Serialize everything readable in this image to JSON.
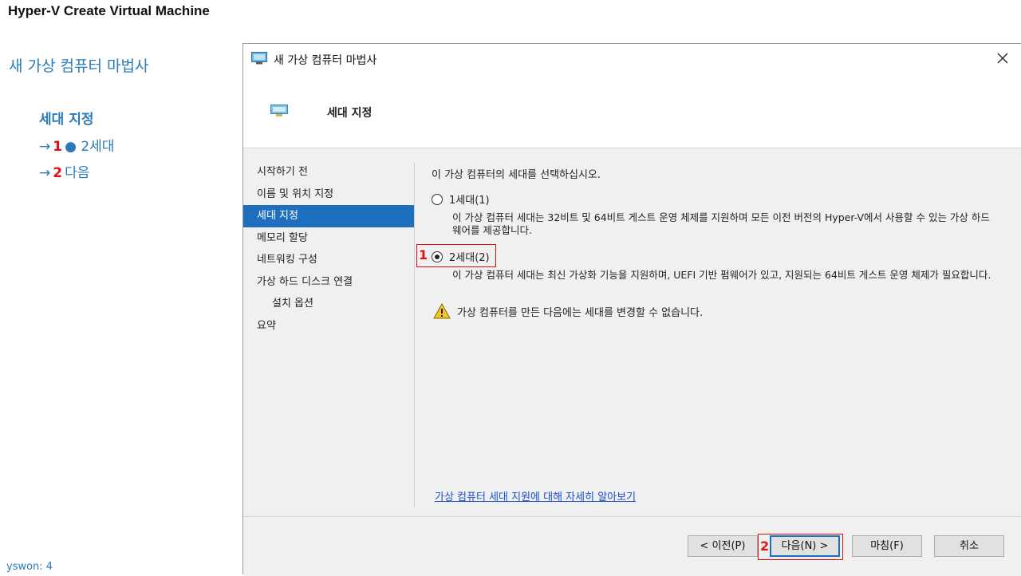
{
  "page_title": "Hyper-V Create Virtual Machine",
  "guide": {
    "title": "새 가상 컴퓨터 마법사",
    "section": "세대 지정",
    "steps": [
      {
        "arrow": "→",
        "num": "1",
        "bullet": "●",
        "text": "2세대"
      },
      {
        "arrow": "→",
        "num": "2",
        "text": "다음"
      }
    ]
  },
  "footer_note": "yswon:   4",
  "dialog": {
    "title": "새 가상 컴퓨터 마법사",
    "header": "세대 지정",
    "nav": [
      {
        "label": "시작하기 전",
        "selected": false
      },
      {
        "label": "이름 및 위치 지정",
        "selected": false
      },
      {
        "label": "세대 지정",
        "selected": true
      },
      {
        "label": "메모리 할당",
        "selected": false
      },
      {
        "label": "네트워킹 구성",
        "selected": false
      },
      {
        "label": "가상 하드 디스크 연결",
        "selected": false
      },
      {
        "label": "설치 옵션",
        "selected": false
      },
      {
        "label": "요약",
        "selected": false
      }
    ],
    "prompt": "이 가상 컴퓨터의 세대를 선택하십시오.",
    "option_gen1": {
      "label": "1세대(1)",
      "checked": false,
      "description": "이 가상 컴퓨터 세대는 32비트 및 64비트 게스트 운영 체제를 지원하며 모든 이전 버전의 Hyper-V에서 사용할 수 있는 가상 하드웨어를 제공합니다."
    },
    "option_gen2": {
      "label": "2세대(2)",
      "checked": true,
      "description": "이 가상 컴퓨터 세대는 최신 가상화 기능을 지원하며, UEFI 기반 펌웨어가 있고, 지원되는 64비트 게스트 운영 체제가 필요합니다."
    },
    "warning": "가상 컴퓨터를 만든 다음에는 세대를 변경할 수 없습니다.",
    "learn_more": "가상 컴퓨터 세대 지원에 대해 자세히 알아보기",
    "buttons": {
      "previous": "< 이전(P)",
      "next": "다음(N) >",
      "finish": "마침(F)",
      "cancel": "취소"
    },
    "annotations": {
      "gen2": "1",
      "next": "2"
    }
  },
  "colors": {
    "accent_blue": "#2a7ab8",
    "selection": "#1f6fbf",
    "annotation_red": "#e01010",
    "link": "#1a4fd0"
  },
  "icons": [
    "hyperv-window-icon",
    "close-icon",
    "wizard-header-icon",
    "warning-icon"
  ]
}
